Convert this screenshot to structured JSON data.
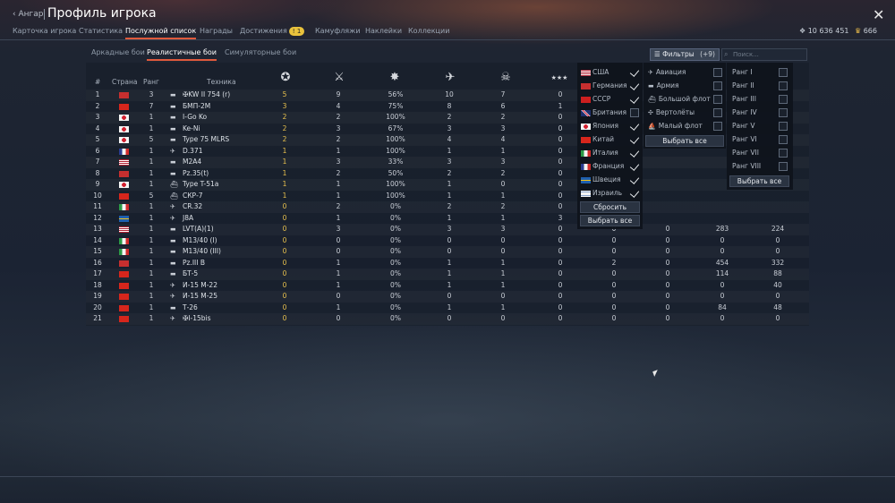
{
  "header": {
    "back_label": "Ангар",
    "title": "Профиль игрока"
  },
  "tabs": [
    {
      "label": "Карточка игрока"
    },
    {
      "label": "Статистика"
    },
    {
      "label": "Послужной список"
    },
    {
      "label": "Награды"
    },
    {
      "label": "Достижения",
      "badge": "1"
    },
    {
      "label": "Камуфляжи"
    },
    {
      "label": "Наклейки"
    },
    {
      "label": "Коллекции"
    }
  ],
  "currency": {
    "silver": "10 636 451",
    "gold": "666"
  },
  "modes": [
    {
      "label": "Аркадные бои"
    },
    {
      "label": "Реалистичные бои"
    },
    {
      "label": "Симуляторные бои"
    }
  ],
  "table": {
    "headers": {
      "num": "#",
      "country": "Страна",
      "rank": "Ранг",
      "vehicle": "Техника"
    },
    "header_icons": [
      "victories-icon",
      "battles-icon",
      "win-rate-icon",
      "air-kills-icon",
      "ground-kills-icon",
      "naval-kills-icon"
    ],
    "rows": [
      {
        "n": "1",
        "country": "de",
        "rank": "3",
        "type": "tank",
        "name": "✠KW II 754 (r)",
        "c": [
          "5",
          "9",
          "56%",
          "10",
          "7",
          "0",
          "",
          "",
          "",
          ""
        ]
      },
      {
        "n": "2",
        "country": "cn",
        "rank": "7",
        "type": "tank",
        "name": "БМП-2М",
        "c": [
          "3",
          "4",
          "75%",
          "8",
          "6",
          "1",
          "",
          "",
          "",
          ""
        ]
      },
      {
        "n": "3",
        "country": "jp",
        "rank": "1",
        "type": "tank",
        "name": "I-Go Ko",
        "c": [
          "2",
          "2",
          "100%",
          "2",
          "2",
          "0",
          "",
          "",
          "",
          ""
        ]
      },
      {
        "n": "4",
        "country": "jp",
        "rank": "1",
        "type": "tank",
        "name": "Ke-Ni",
        "c": [
          "2",
          "3",
          "67%",
          "3",
          "3",
          "0",
          "",
          "",
          "",
          ""
        ]
      },
      {
        "n": "5",
        "country": "jp",
        "rank": "5",
        "type": "tank",
        "name": "Type 75 MLRS",
        "c": [
          "2",
          "2",
          "100%",
          "4",
          "4",
          "0",
          "",
          "",
          "",
          ""
        ]
      },
      {
        "n": "6",
        "country": "fr",
        "rank": "1",
        "type": "plane",
        "name": "D.371",
        "c": [
          "1",
          "1",
          "100%",
          "1",
          "1",
          "0",
          "",
          "",
          "",
          ""
        ]
      },
      {
        "n": "7",
        "country": "us",
        "rank": "1",
        "type": "tank",
        "name": "M2A4",
        "c": [
          "1",
          "3",
          "33%",
          "3",
          "3",
          "0",
          "",
          "",
          "",
          ""
        ]
      },
      {
        "n": "8",
        "country": "de",
        "rank": "1",
        "type": "tank",
        "name": "Pz.35(t)",
        "c": [
          "1",
          "2",
          "50%",
          "2",
          "2",
          "0",
          "",
          "",
          "",
          ""
        ]
      },
      {
        "n": "9",
        "country": "jp",
        "rank": "1",
        "type": "ship",
        "name": "Type T-51a",
        "c": [
          "1",
          "1",
          "100%",
          "1",
          "0",
          "0",
          "",
          "",
          "",
          ""
        ]
      },
      {
        "n": "10",
        "country": "cn",
        "rank": "5",
        "type": "ship",
        "name": "СКР-7",
        "c": [
          "1",
          "1",
          "100%",
          "1",
          "1",
          "0",
          "",
          "",
          "",
          ""
        ]
      },
      {
        "n": "11",
        "country": "it",
        "rank": "1",
        "type": "plane",
        "name": "CR.32",
        "c": [
          "0",
          "2",
          "0%",
          "2",
          "2",
          "0",
          "",
          "",
          "",
          ""
        ]
      },
      {
        "n": "12",
        "country": "se",
        "rank": "1",
        "type": "plane",
        "name": "J8A",
        "c": [
          "0",
          "1",
          "0%",
          "1",
          "1",
          "3",
          "",
          "",
          "",
          ""
        ]
      },
      {
        "n": "13",
        "country": "us",
        "rank": "1",
        "type": "tank",
        "name": "LVT(A)(1)",
        "c": [
          "0",
          "3",
          "0%",
          "3",
          "3",
          "0",
          "0",
          "0",
          "283",
          "224"
        ]
      },
      {
        "n": "14",
        "country": "it",
        "rank": "1",
        "type": "tank",
        "name": "M13/40 (I)",
        "c": [
          "0",
          "0",
          "0%",
          "0",
          "0",
          "0",
          "0",
          "0",
          "0",
          "0"
        ]
      },
      {
        "n": "15",
        "country": "it",
        "rank": "1",
        "type": "tank",
        "name": "M13/40 (III)",
        "c": [
          "0",
          "0",
          "0%",
          "0",
          "0",
          "0",
          "0",
          "0",
          "0",
          "0"
        ]
      },
      {
        "n": "16",
        "country": "de",
        "rank": "1",
        "type": "tank",
        "name": "Pz.III B",
        "c": [
          "0",
          "1",
          "0%",
          "1",
          "1",
          "0",
          "2",
          "0",
          "454",
          "332"
        ]
      },
      {
        "n": "17",
        "country": "cn",
        "rank": "1",
        "type": "tank",
        "name": "БТ-5",
        "c": [
          "0",
          "1",
          "0%",
          "1",
          "1",
          "0",
          "0",
          "0",
          "114",
          "88"
        ]
      },
      {
        "n": "18",
        "country": "cn",
        "rank": "1",
        "type": "plane",
        "name": "И-15 М-22",
        "c": [
          "0",
          "1",
          "0%",
          "1",
          "1",
          "0",
          "0",
          "0",
          "0",
          "40"
        ]
      },
      {
        "n": "19",
        "country": "cn",
        "rank": "1",
        "type": "plane",
        "name": "И-15 М-25",
        "c": [
          "0",
          "0",
          "0%",
          "0",
          "0",
          "0",
          "0",
          "0",
          "0",
          "0"
        ]
      },
      {
        "n": "20",
        "country": "cn",
        "rank": "1",
        "type": "tank",
        "name": "Т-26",
        "c": [
          "0",
          "1",
          "0%",
          "1",
          "1",
          "0",
          "0",
          "0",
          "84",
          "48"
        ]
      },
      {
        "n": "21",
        "country": "cn",
        "rank": "1",
        "type": "plane",
        "name": "✠I-15bis",
        "c": [
          "0",
          "0",
          "0%",
          "0",
          "0",
          "0",
          "0",
          "0",
          "0",
          "0"
        ]
      }
    ]
  },
  "filter": {
    "button_label": "Фильтры",
    "count": "(+9)",
    "search_placeholder": "Поиск...",
    "countries": [
      {
        "label": "США",
        "flag": "us",
        "checked": true
      },
      {
        "label": "Германия",
        "flag": "de",
        "checked": true
      },
      {
        "label": "СССР",
        "flag": "su",
        "checked": true
      },
      {
        "label": "Британия",
        "flag": "gb",
        "checked": false
      },
      {
        "label": "Япония",
        "flag": "jp",
        "checked": true
      },
      {
        "label": "Китай",
        "flag": "cn",
        "checked": true
      },
      {
        "label": "Италия",
        "flag": "it",
        "checked": true
      },
      {
        "label": "Франция",
        "flag": "fr",
        "checked": true
      },
      {
        "label": "Швеция",
        "flag": "se",
        "checked": true
      },
      {
        "label": "Израиль",
        "flag": "il",
        "checked": true
      }
    ],
    "reset_label": "Сбросить",
    "select_all_label": "Выбрать все",
    "types": [
      {
        "label": "Авиация",
        "icon": "plane-icon",
        "checked": false
      },
      {
        "label": "Армия",
        "icon": "tank-icon",
        "checked": false
      },
      {
        "label": "Большой флот",
        "icon": "big-ship-icon",
        "checked": false
      },
      {
        "label": "Вертолёты",
        "icon": "helicopter-icon",
        "checked": false
      },
      {
        "label": "Малый флот",
        "icon": "boat-icon",
        "checked": false
      }
    ],
    "ranks": [
      {
        "label": "Ранг I",
        "checked": false
      },
      {
        "label": "Ранг II",
        "checked": false
      },
      {
        "label": "Ранг III",
        "checked": false
      },
      {
        "label": "Ранг IV",
        "checked": false
      },
      {
        "label": "Ранг V",
        "checked": false
      },
      {
        "label": "Ранг VI",
        "checked": false
      },
      {
        "label": "Ранг VII",
        "checked": false
      },
      {
        "label": "Ранг VIII",
        "checked": false
      }
    ]
  },
  "colors": {
    "accent": "#e05a3c",
    "gold": "#e8c14d"
  }
}
